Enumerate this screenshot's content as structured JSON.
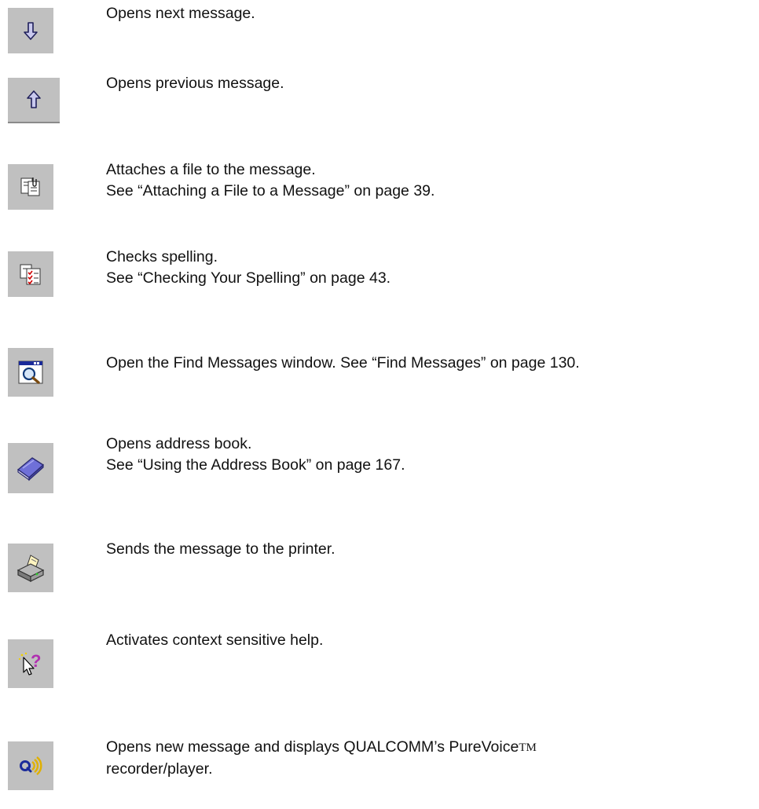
{
  "items": [
    {
      "icon": "arrow-down-icon",
      "lines": [
        "Opens next message."
      ]
    },
    {
      "icon": "arrow-up-icon",
      "lines": [
        "Opens previous message."
      ]
    },
    {
      "icon": "attach-file-icon",
      "lines": [
        "Attaches a file to the message.",
        "See “Attaching a File to a Message” on page 39."
      ]
    },
    {
      "icon": "spell-check-icon",
      "lines": [
        "Checks spelling.",
        "See “Checking Your Spelling” on page 43."
      ]
    },
    {
      "icon": "find-messages-icon",
      "lines": [
        "Open the Find Messages window. See “Find Messages” on page 130."
      ]
    },
    {
      "icon": "address-book-icon",
      "lines": [
        "Opens address book.",
        "See “Using the Address Book” on page 167."
      ]
    },
    {
      "icon": "printer-icon",
      "lines": [
        "Sends the message to the printer."
      ]
    },
    {
      "icon": "context-help-icon",
      "lines": [
        "Activates context sensitive help."
      ]
    },
    {
      "icon": "purevoice-icon",
      "lines": [
        "Opens new message and displays QUALCOMM’s PureVoice",
        "recorder/player."
      ],
      "trademark": "TM"
    }
  ]
}
